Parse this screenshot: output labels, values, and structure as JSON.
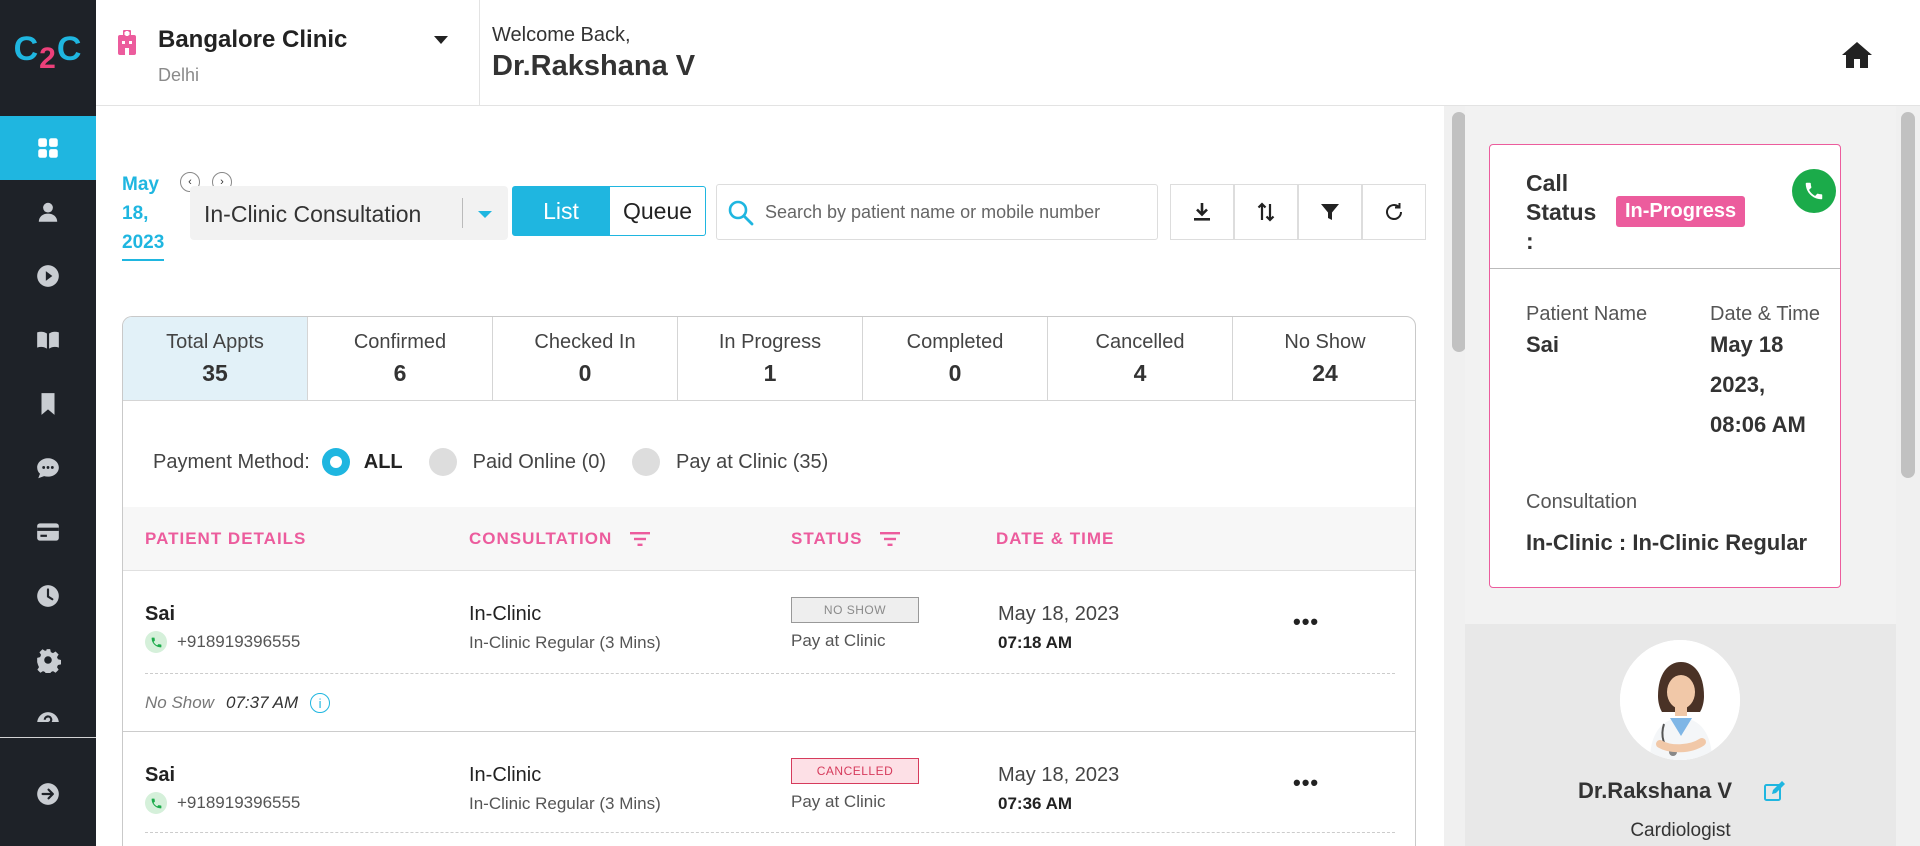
{
  "app": {
    "logo": {
      "c1": "C",
      "two": "2",
      "c2": "C"
    },
    "nav": [
      {
        "name": "dashboard",
        "icon": "grid-icon",
        "active": true
      },
      {
        "name": "patients",
        "icon": "person-icon"
      },
      {
        "name": "video",
        "icon": "play-circle-icon"
      },
      {
        "name": "library",
        "icon": "book-icon"
      },
      {
        "name": "bookmarks",
        "icon": "bookmark-icon"
      },
      {
        "name": "messages",
        "icon": "chat-icon"
      },
      {
        "name": "billing",
        "icon": "card-icon"
      },
      {
        "name": "history",
        "icon": "clock-icon"
      },
      {
        "name": "settings",
        "icon": "gear-icon"
      },
      {
        "name": "help",
        "icon": "help-icon"
      },
      {
        "name": "logout",
        "icon": "arrow-right-circle-icon"
      }
    ],
    "colors": {
      "accent": "#1fb6e0",
      "pink": "#ec5c9d",
      "sidebar": "#1e2228",
      "call": "#1bab4a"
    }
  },
  "header": {
    "clinic_name": "Bangalore Clinic",
    "clinic_city": "Delhi",
    "welcome": "Welcome Back,",
    "doctor_name": "Dr.Rakshana V"
  },
  "toolbar": {
    "date": "May 18, 2023",
    "date_parts": [
      "May",
      "18,",
      "2023"
    ],
    "consultation_type": "In-Clinic Consultation",
    "view_list": "List",
    "view_queue": "Queue",
    "search_placeholder": "Search by patient name or mobile number",
    "search_value": ""
  },
  "stats": [
    {
      "label": "Total Appts",
      "value": "35",
      "active": true
    },
    {
      "label": "Confirmed",
      "value": "6"
    },
    {
      "label": "Checked In",
      "value": "0"
    },
    {
      "label": "In Progress",
      "value": "1"
    },
    {
      "label": "Completed",
      "value": "0"
    },
    {
      "label": "Cancelled",
      "value": "4"
    },
    {
      "label": "No Show",
      "value": "24"
    }
  ],
  "payment": {
    "label": "Payment Method:",
    "options": [
      "ALL",
      "Paid Online (0)",
      "Pay at Clinic (35)"
    ],
    "selected": "ALL"
  },
  "table": {
    "headers": [
      "PATIENT DETAILS",
      "CONSULTATION",
      "STATUS",
      "DATE & TIME"
    ],
    "rows": [
      {
        "name": "Sai",
        "phone": "+918919396555",
        "consult_type": "In-Clinic",
        "consult_sub": "In-Clinic Regular (3 Mins)",
        "status": "NO SHOW",
        "payment": "Pay at Clinic",
        "date": "May 18, 2023",
        "time": "07:18 AM",
        "note_status": "No Show",
        "note_time": "07:37 AM"
      },
      {
        "name": "Sai",
        "phone": "+918919396555",
        "consult_type": "In-Clinic",
        "consult_sub": "In-Clinic Regular (3 Mins)",
        "status": "CANCELLED",
        "payment": "Pay at Clinic",
        "date": "May 18, 2023",
        "time": "07:36 AM"
      }
    ]
  },
  "call_panel": {
    "label": "Call Status :",
    "label_parts": [
      "Call",
      "Status",
      ":"
    ],
    "status": "In-Progress",
    "patient_label": "Patient Name",
    "patient_value": "Sai",
    "datetime_label": "Date & Time",
    "datetime_parts": [
      "May 18",
      "2023,",
      "08:06 AM"
    ],
    "consult_label": "Consultation",
    "consult_value": "In-Clinic : In-Clinic Regular"
  },
  "profile": {
    "name": "Dr.Rakshana V",
    "specialty": "Cardiologist"
  }
}
